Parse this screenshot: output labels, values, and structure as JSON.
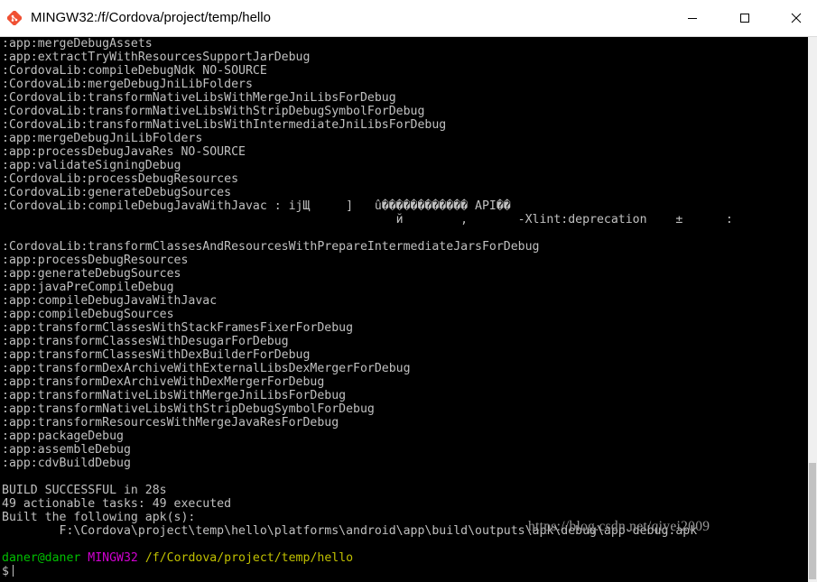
{
  "window": {
    "title": "MINGW32:/f/Cordova/project/temp/hello",
    "icon": "git-bash-icon",
    "controls": {
      "minimize": "minimize-icon",
      "maximize": "maximize-icon",
      "close": "close-icon"
    }
  },
  "terminal": {
    "background": "#000000",
    "text_color": "#c0c0c0",
    "lines": [
      ":app:mergeDebugAssets",
      ":app:extractTryWithResourcesSupportJarDebug",
      ":CordovaLib:compileDebugNdk NO-SOURCE",
      ":CordovaLib:mergeDebugJniLibFolders",
      ":CordovaLib:transformNativeLibsWithMergeJniLibsForDebug",
      ":CordovaLib:transformNativeLibsWithStripDebugSymbolForDebug",
      ":CordovaLib:transformNativeLibsWithIntermediateJniLibsForDebug",
      ":app:mergeDebugJniLibFolders",
      ":app:processDebugJavaRes NO-SOURCE",
      ":app:validateSigningDebug",
      ":CordovaLib:processDebugResources",
      ":CordovaLib:generateDebugSources",
      ":CordovaLib:compileDebugJavaWithJavac : ijЩ     ]   û������������ API��",
      "                                                       й        ,       -Xlint:deprecation    ±      :",
      "",
      ":CordovaLib:transformClassesAndResourcesWithPrepareIntermediateJarsForDebug",
      ":app:processDebugResources",
      ":app:generateDebugSources",
      ":app:javaPreCompileDebug",
      ":app:compileDebugJavaWithJavac",
      ":app:compileDebugSources",
      ":app:transformClassesWithStackFramesFixerForDebug",
      ":app:transformClassesWithDesugarForDebug",
      ":app:transformClassesWithDexBuilderForDebug",
      ":app:transformDexArchiveWithExternalLibsDexMergerForDebug",
      ":app:transformDexArchiveWithDexMergerForDebug",
      ":app:transformNativeLibsWithMergeJniLibsForDebug",
      ":app:transformNativeLibsWithStripDebugSymbolForDebug",
      ":app:transformResourcesWithMergeJavaResForDebug",
      ":app:packageDebug",
      ":app:assembleDebug",
      ":app:cdvBuildDebug",
      "",
      "BUILD SUCCESSFUL in 28s",
      "49 actionable tasks: 49 executed",
      "Built the following apk(s):",
      "        F:\\Cordova\\project\\temp\\hello\\platforms\\android\\app\\build\\outputs\\apk\\debug\\app-debug.apk",
      ""
    ],
    "prompt": {
      "user": "daner@daner",
      "host": "MINGW32",
      "path": "/f/Cordova/project/temp/hello",
      "symbol": "$"
    }
  },
  "watermark": "https://blog.csdn.net/qiyei2009",
  "colors": {
    "prompt_user": "#00c000",
    "prompt_host": "#d000d0",
    "prompt_path": "#c0c000"
  }
}
